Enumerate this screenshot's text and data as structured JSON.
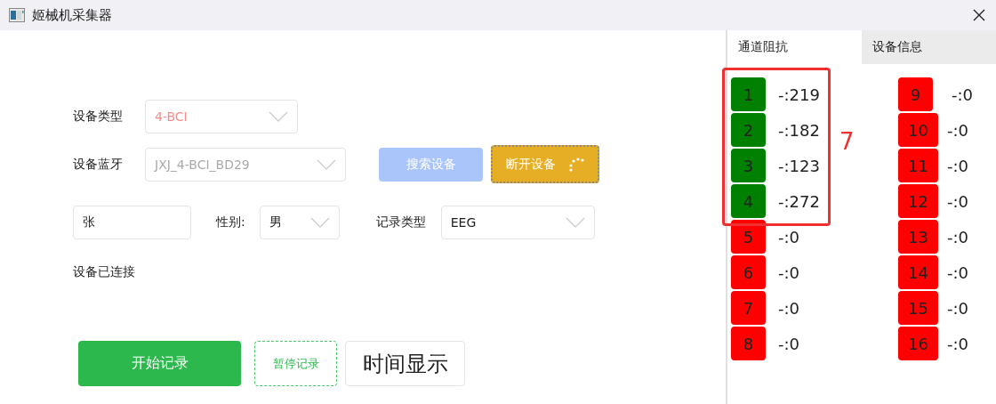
{
  "window": {
    "title": "姬械机采集器"
  },
  "form": {
    "device_type": {
      "label": "设备类型",
      "value": "4-BCI"
    },
    "bluetooth": {
      "label": "设备蓝牙",
      "value": "JXJ_4-BCI_BD29",
      "disabled": true
    },
    "search_button": {
      "label": "搜索设备",
      "disabled": true
    },
    "disconnect_button": {
      "label": "断开设备",
      "busy": true
    },
    "name": {
      "value": "张"
    },
    "gender": {
      "label": "性别:",
      "value": "男"
    },
    "record_type": {
      "label": "记录类型",
      "value": "EEG"
    },
    "status": "设备已连接"
  },
  "buttons": [
    {
      "label": "开始记录",
      "kind": "primary"
    },
    {
      "label": "暂停记录",
      "kind": "dashed"
    },
    {
      "label": "时间显示",
      "kind": "large"
    }
  ],
  "tabs": [
    {
      "label": "通道阻抗",
      "selected": true
    },
    {
      "label": "设备信息",
      "selected": false
    }
  ],
  "channels": [
    {
      "number": "1",
      "reading": "-:219",
      "color": "#008000"
    },
    {
      "number": "2",
      "reading": "-:182",
      "color": "#008000"
    },
    {
      "number": "3",
      "reading": "-:123",
      "color": "#008000"
    },
    {
      "number": "4",
      "reading": "-:272",
      "color": "#008000"
    },
    {
      "number": "5",
      "reading": "-:0",
      "color": "#ff0000"
    },
    {
      "number": "6",
      "reading": "-:0",
      "color": "#ff0000"
    },
    {
      "number": "7",
      "reading": "-:0",
      "color": "#ff0000"
    },
    {
      "number": "8",
      "reading": "-:0",
      "color": "#ff0000"
    },
    {
      "number": "9",
      "reading": "-:0",
      "color": "#ff0000"
    },
    {
      "number": "10",
      "reading": "-:0",
      "color": "#ff0000"
    },
    {
      "number": "11",
      "reading": "-:0",
      "color": "#ff0000"
    },
    {
      "number": "12",
      "reading": "-:0",
      "color": "#ff0000"
    },
    {
      "number": "13",
      "reading": "-:0",
      "color": "#ff0000"
    },
    {
      "number": "14",
      "reading": "-:0",
      "color": "#ff0000"
    },
    {
      "number": "15",
      "reading": "-:0",
      "color": "#ff0000"
    },
    {
      "number": "16",
      "reading": "-:0",
      "color": "#ff0000"
    }
  ],
  "annotation": {
    "label": "7"
  }
}
